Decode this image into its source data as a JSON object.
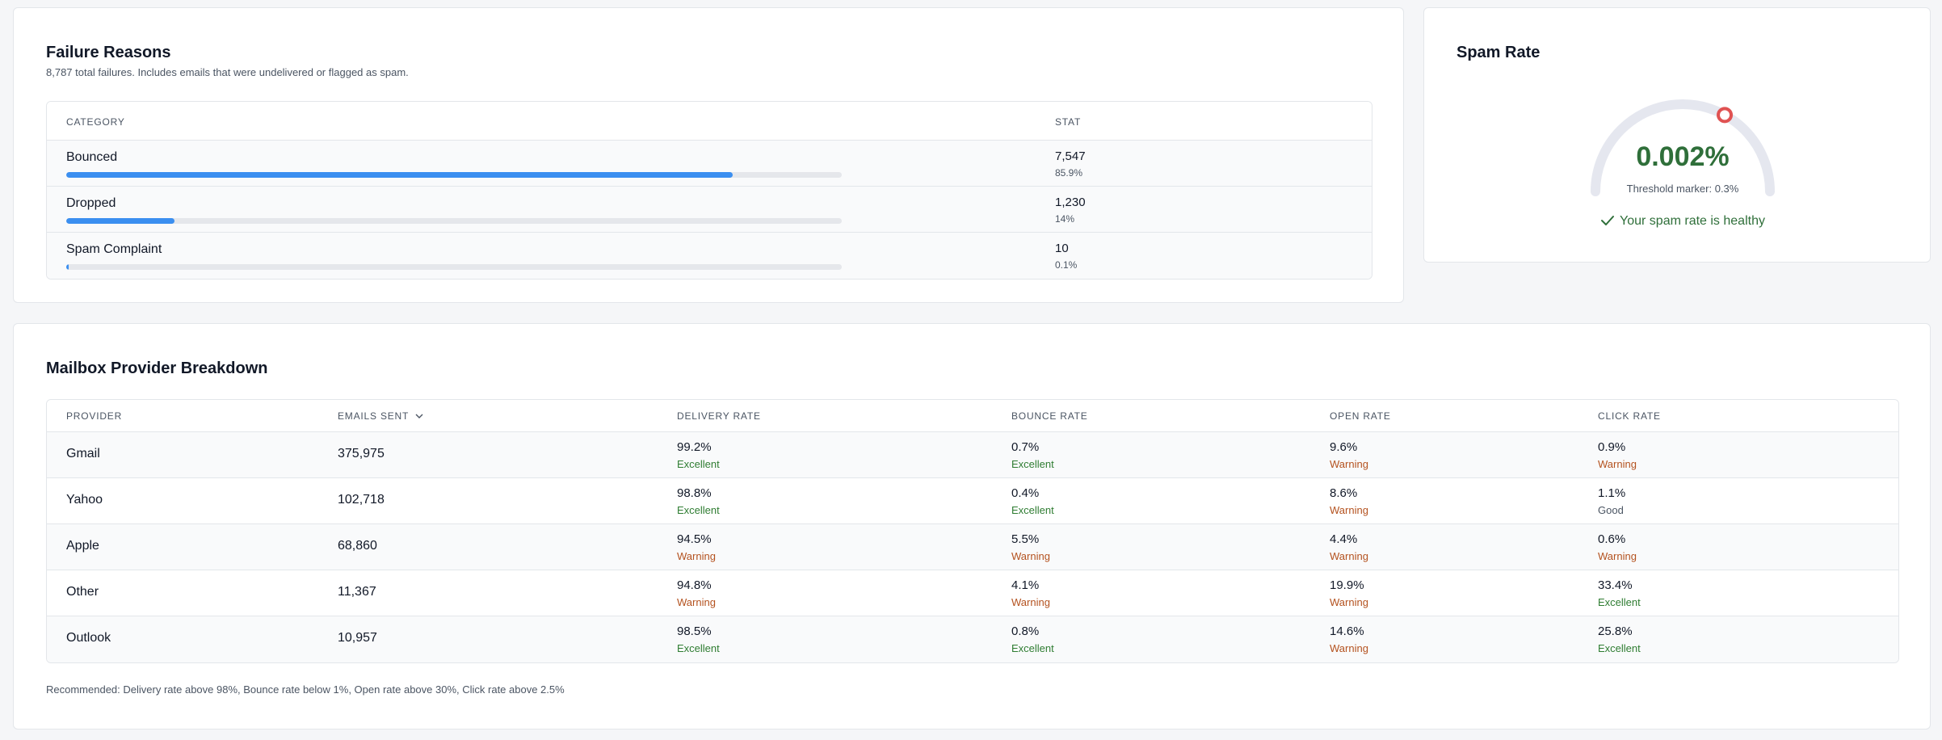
{
  "colors": {
    "bar": "#3b8ff0",
    "excellent": "#2f7d32",
    "warning": "#b4521f",
    "good": "#4b5563",
    "healthy": "#2f6f3a",
    "gauge_marker": "#e05252"
  },
  "failure": {
    "title": "Failure Reasons",
    "subtitle": "8,787 total failures. Includes emails that were undelivered or flagged as spam.",
    "headers": {
      "category": "CATEGORY",
      "stat": "STAT"
    },
    "rows": [
      {
        "category": "Bounced",
        "stat": "7,547",
        "pct": "85.9%",
        "fill": 0.859
      },
      {
        "category": "Dropped",
        "stat": "1,230",
        "pct": "14%",
        "fill": 0.14
      },
      {
        "category": "Spam Complaint",
        "stat": "10",
        "pct": "0.1%",
        "fill": 0.001
      }
    ]
  },
  "spam": {
    "title": "Spam Rate",
    "value": "0.002%",
    "caption": "Threshold marker: 0.3%",
    "marker_fraction": 0.66,
    "status": "Your spam rate is healthy",
    "status_icon": "check-icon"
  },
  "providers": {
    "title": "Mailbox Provider Breakdown",
    "headers": {
      "provider": "PROVIDER",
      "sent": "EMAILS SENT",
      "delivery": "DELIVERY RATE",
      "bounce": "BOUNCE RATE",
      "open": "OPEN RATE",
      "click": "CLICK RATE"
    },
    "sort_icon": "chevron-down-icon",
    "rows": [
      {
        "provider": "Gmail",
        "sent": "375,975",
        "delivery": {
          "value": "99.2%",
          "label": "Excellent"
        },
        "bounce": {
          "value": "0.7%",
          "label": "Excellent"
        },
        "open": {
          "value": "9.6%",
          "label": "Warning"
        },
        "click": {
          "value": "0.9%",
          "label": "Warning"
        }
      },
      {
        "provider": "Yahoo",
        "sent": "102,718",
        "delivery": {
          "value": "98.8%",
          "label": "Excellent"
        },
        "bounce": {
          "value": "0.4%",
          "label": "Excellent"
        },
        "open": {
          "value": "8.6%",
          "label": "Warning"
        },
        "click": {
          "value": "1.1%",
          "label": "Good"
        }
      },
      {
        "provider": "Apple",
        "sent": "68,860",
        "delivery": {
          "value": "94.5%",
          "label": "Warning"
        },
        "bounce": {
          "value": "5.5%",
          "label": "Warning"
        },
        "open": {
          "value": "4.4%",
          "label": "Warning"
        },
        "click": {
          "value": "0.6%",
          "label": "Warning"
        }
      },
      {
        "provider": "Other",
        "sent": "11,367",
        "delivery": {
          "value": "94.8%",
          "label": "Warning"
        },
        "bounce": {
          "value": "4.1%",
          "label": "Warning"
        },
        "open": {
          "value": "19.9%",
          "label": "Warning"
        },
        "click": {
          "value": "33.4%",
          "label": "Excellent"
        }
      },
      {
        "provider": "Outlook",
        "sent": "10,957",
        "delivery": {
          "value": "98.5%",
          "label": "Excellent"
        },
        "bounce": {
          "value": "0.8%",
          "label": "Excellent"
        },
        "open": {
          "value": "14.6%",
          "label": "Warning"
        },
        "click": {
          "value": "25.8%",
          "label": "Excellent"
        }
      }
    ],
    "footnote": "Recommended: Delivery rate above 98%, Bounce rate below 1%, Open rate above 30%, Click rate above 2.5%"
  }
}
